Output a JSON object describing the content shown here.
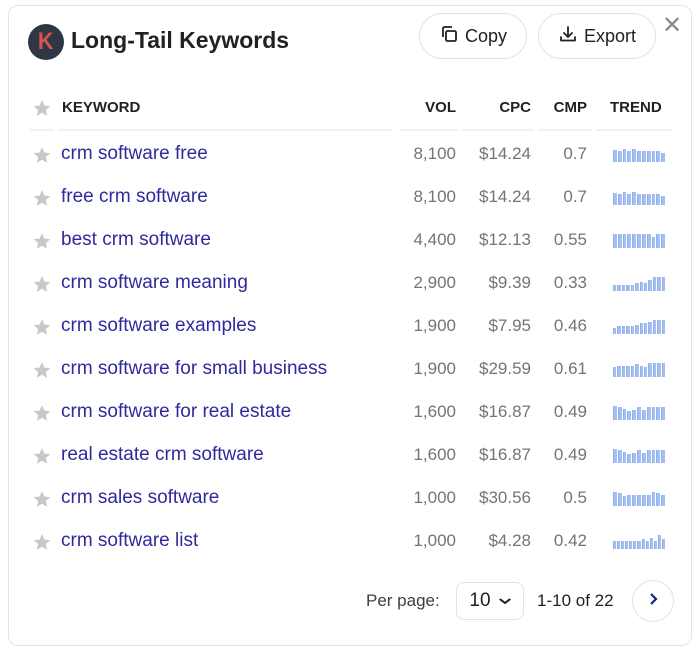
{
  "header": {
    "logo_letter": "K",
    "title": "Long-Tail Keywords",
    "copy_label": "Copy",
    "export_label": "Export",
    "close_symbol": "✕"
  },
  "table": {
    "columns": {
      "keyword": "KEYWORD",
      "vol": "VOL",
      "cpc": "CPC",
      "cmp": "CMP",
      "trend": "TREND"
    },
    "rows": [
      {
        "keyword": "crm software free",
        "vol": "8,100",
        "cpc": "$14.24",
        "cmp": "0.7",
        "trend": [
          0.85,
          0.75,
          0.9,
          0.75,
          0.95,
          0.8,
          0.8,
          0.8,
          0.8,
          0.75,
          0.65
        ]
      },
      {
        "keyword": "free crm software",
        "vol": "8,100",
        "cpc": "$14.24",
        "cmp": "0.7",
        "trend": [
          0.85,
          0.75,
          0.9,
          0.75,
          0.95,
          0.8,
          0.8,
          0.8,
          0.8,
          0.75,
          0.65
        ]
      },
      {
        "keyword": "best crm software",
        "vol": "4,400",
        "cpc": "$12.13",
        "cmp": "0.55",
        "trend": [
          1,
          1,
          1,
          1,
          1,
          1,
          1,
          1,
          0.75,
          1,
          1
        ]
      },
      {
        "keyword": "crm software meaning",
        "vol": "2,900",
        "cpc": "$9.39",
        "cmp": "0.33",
        "trend": [
          0.4,
          0.4,
          0.4,
          0.4,
          0.4,
          0.55,
          0.65,
          0.55,
          0.75,
          1,
          1,
          1
        ]
      },
      {
        "keyword": "crm software examples",
        "vol": "1,900",
        "cpc": "$7.95",
        "cmp": "0.46",
        "trend": [
          0.45,
          0.55,
          0.55,
          0.55,
          0.55,
          0.65,
          0.75,
          0.75,
          0.85,
          1,
          1,
          1
        ]
      },
      {
        "keyword": "crm software for small business",
        "vol": "1,900",
        "cpc": "$29.59",
        "cmp": "0.61",
        "trend": [
          0.7,
          0.8,
          0.8,
          0.8,
          0.8,
          0.95,
          0.8,
          0.7,
          1,
          1,
          1,
          1
        ]
      },
      {
        "keyword": "crm software for real estate",
        "vol": "1,600",
        "cpc": "$16.87",
        "cmp": "0.49",
        "trend": [
          1,
          0.95,
          0.75,
          0.65,
          0.7,
          0.9,
          0.7,
          0.9,
          0.9,
          0.9,
          0.9
        ]
      },
      {
        "keyword": "real estate crm software",
        "vol": "1,600",
        "cpc": "$16.87",
        "cmp": "0.49",
        "trend": [
          1,
          0.95,
          0.75,
          0.65,
          0.7,
          0.9,
          0.7,
          0.9,
          0.9,
          0.9,
          0.9
        ]
      },
      {
        "keyword": "crm sales software",
        "vol": "1,000",
        "cpc": "$30.56",
        "cmp": "0.5",
        "trend": [
          1,
          0.9,
          0.7,
          0.8,
          0.8,
          0.8,
          0.8,
          0.8,
          1,
          0.95,
          0.8
        ]
      },
      {
        "keyword": "crm software list",
        "vol": "1,000",
        "cpc": "$4.28",
        "cmp": "0.42",
        "trend": [
          0.6,
          0.6,
          0.6,
          0.6,
          0.6,
          0.6,
          0.6,
          0.7,
          0.6,
          0.8,
          0.6,
          1,
          0.7
        ]
      }
    ]
  },
  "footer": {
    "per_page_label": "Per page:",
    "per_page_value": "10",
    "range_text": "1-10 of 22"
  },
  "colors": {
    "keyword_link": "#2f2a9c",
    "trend_bar": "#a5bff0",
    "logo_bg": "#2f3745",
    "logo_letter": "#d9534f"
  }
}
